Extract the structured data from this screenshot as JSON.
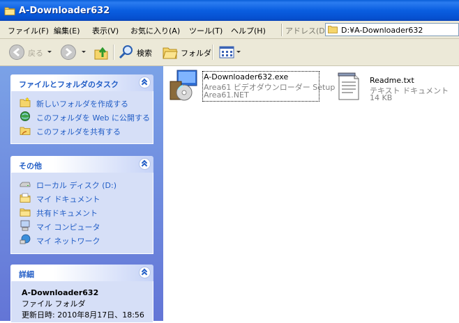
{
  "window": {
    "title": "A-Downloader632"
  },
  "menu": {
    "items": [
      "ファイル(F)",
      "編集(E)",
      "表示(V)",
      "お気に入り(A)",
      "ツール(T)",
      "ヘルプ(H)"
    ],
    "address_label": "アドレス(D)",
    "address_value": "D:¥A-Downloader632"
  },
  "toolbar": {
    "back_label": "戻る",
    "search_label": "検索",
    "folders_label": "フォルダ"
  },
  "tasks_panel": {
    "title": "ファイルとフォルダのタスク",
    "items": [
      {
        "label": "新しいフォルダを作成する",
        "icon": "new-folder-icon"
      },
      {
        "label": "このフォルダを Web に公開する",
        "icon": "publish-web-icon"
      },
      {
        "label": "このフォルダを共有する",
        "icon": "share-folder-icon"
      }
    ]
  },
  "other_places_panel": {
    "title": "その他",
    "items": [
      {
        "label": "ローカル ディスク (D:)",
        "icon": "local-disk-icon"
      },
      {
        "label": "マイ ドキュメント",
        "icon": "my-documents-icon"
      },
      {
        "label": "共有ドキュメント",
        "icon": "shared-documents-icon"
      },
      {
        "label": "マイ コンピュータ",
        "icon": "my-computer-icon"
      },
      {
        "label": "マイ ネットワーク",
        "icon": "my-network-icon"
      }
    ]
  },
  "details_panel": {
    "title": "詳細",
    "name": "A-Downloader632",
    "type": "ファイル フォルダ",
    "modified": "更新日時: 2010年8月17日、18:56"
  },
  "files": [
    {
      "name": "A-Downloader632.exe",
      "description": "Area61 ビデオダウンローダー Setup",
      "sub": "Area61.NET",
      "icon": "installer-icon"
    },
    {
      "name": "Readme.txt",
      "description": "テキスト ドキュメント",
      "sub": "14 KB",
      "icon": "text-document-icon"
    }
  ],
  "colors": {
    "titlebar": "#0a5ee0",
    "taskpane_top": "#7ba2e7",
    "taskpane_bottom": "#6375d6",
    "link": "#215dc6",
    "panel_body": "#d6dff7",
    "chrome": "#ece9d8"
  }
}
